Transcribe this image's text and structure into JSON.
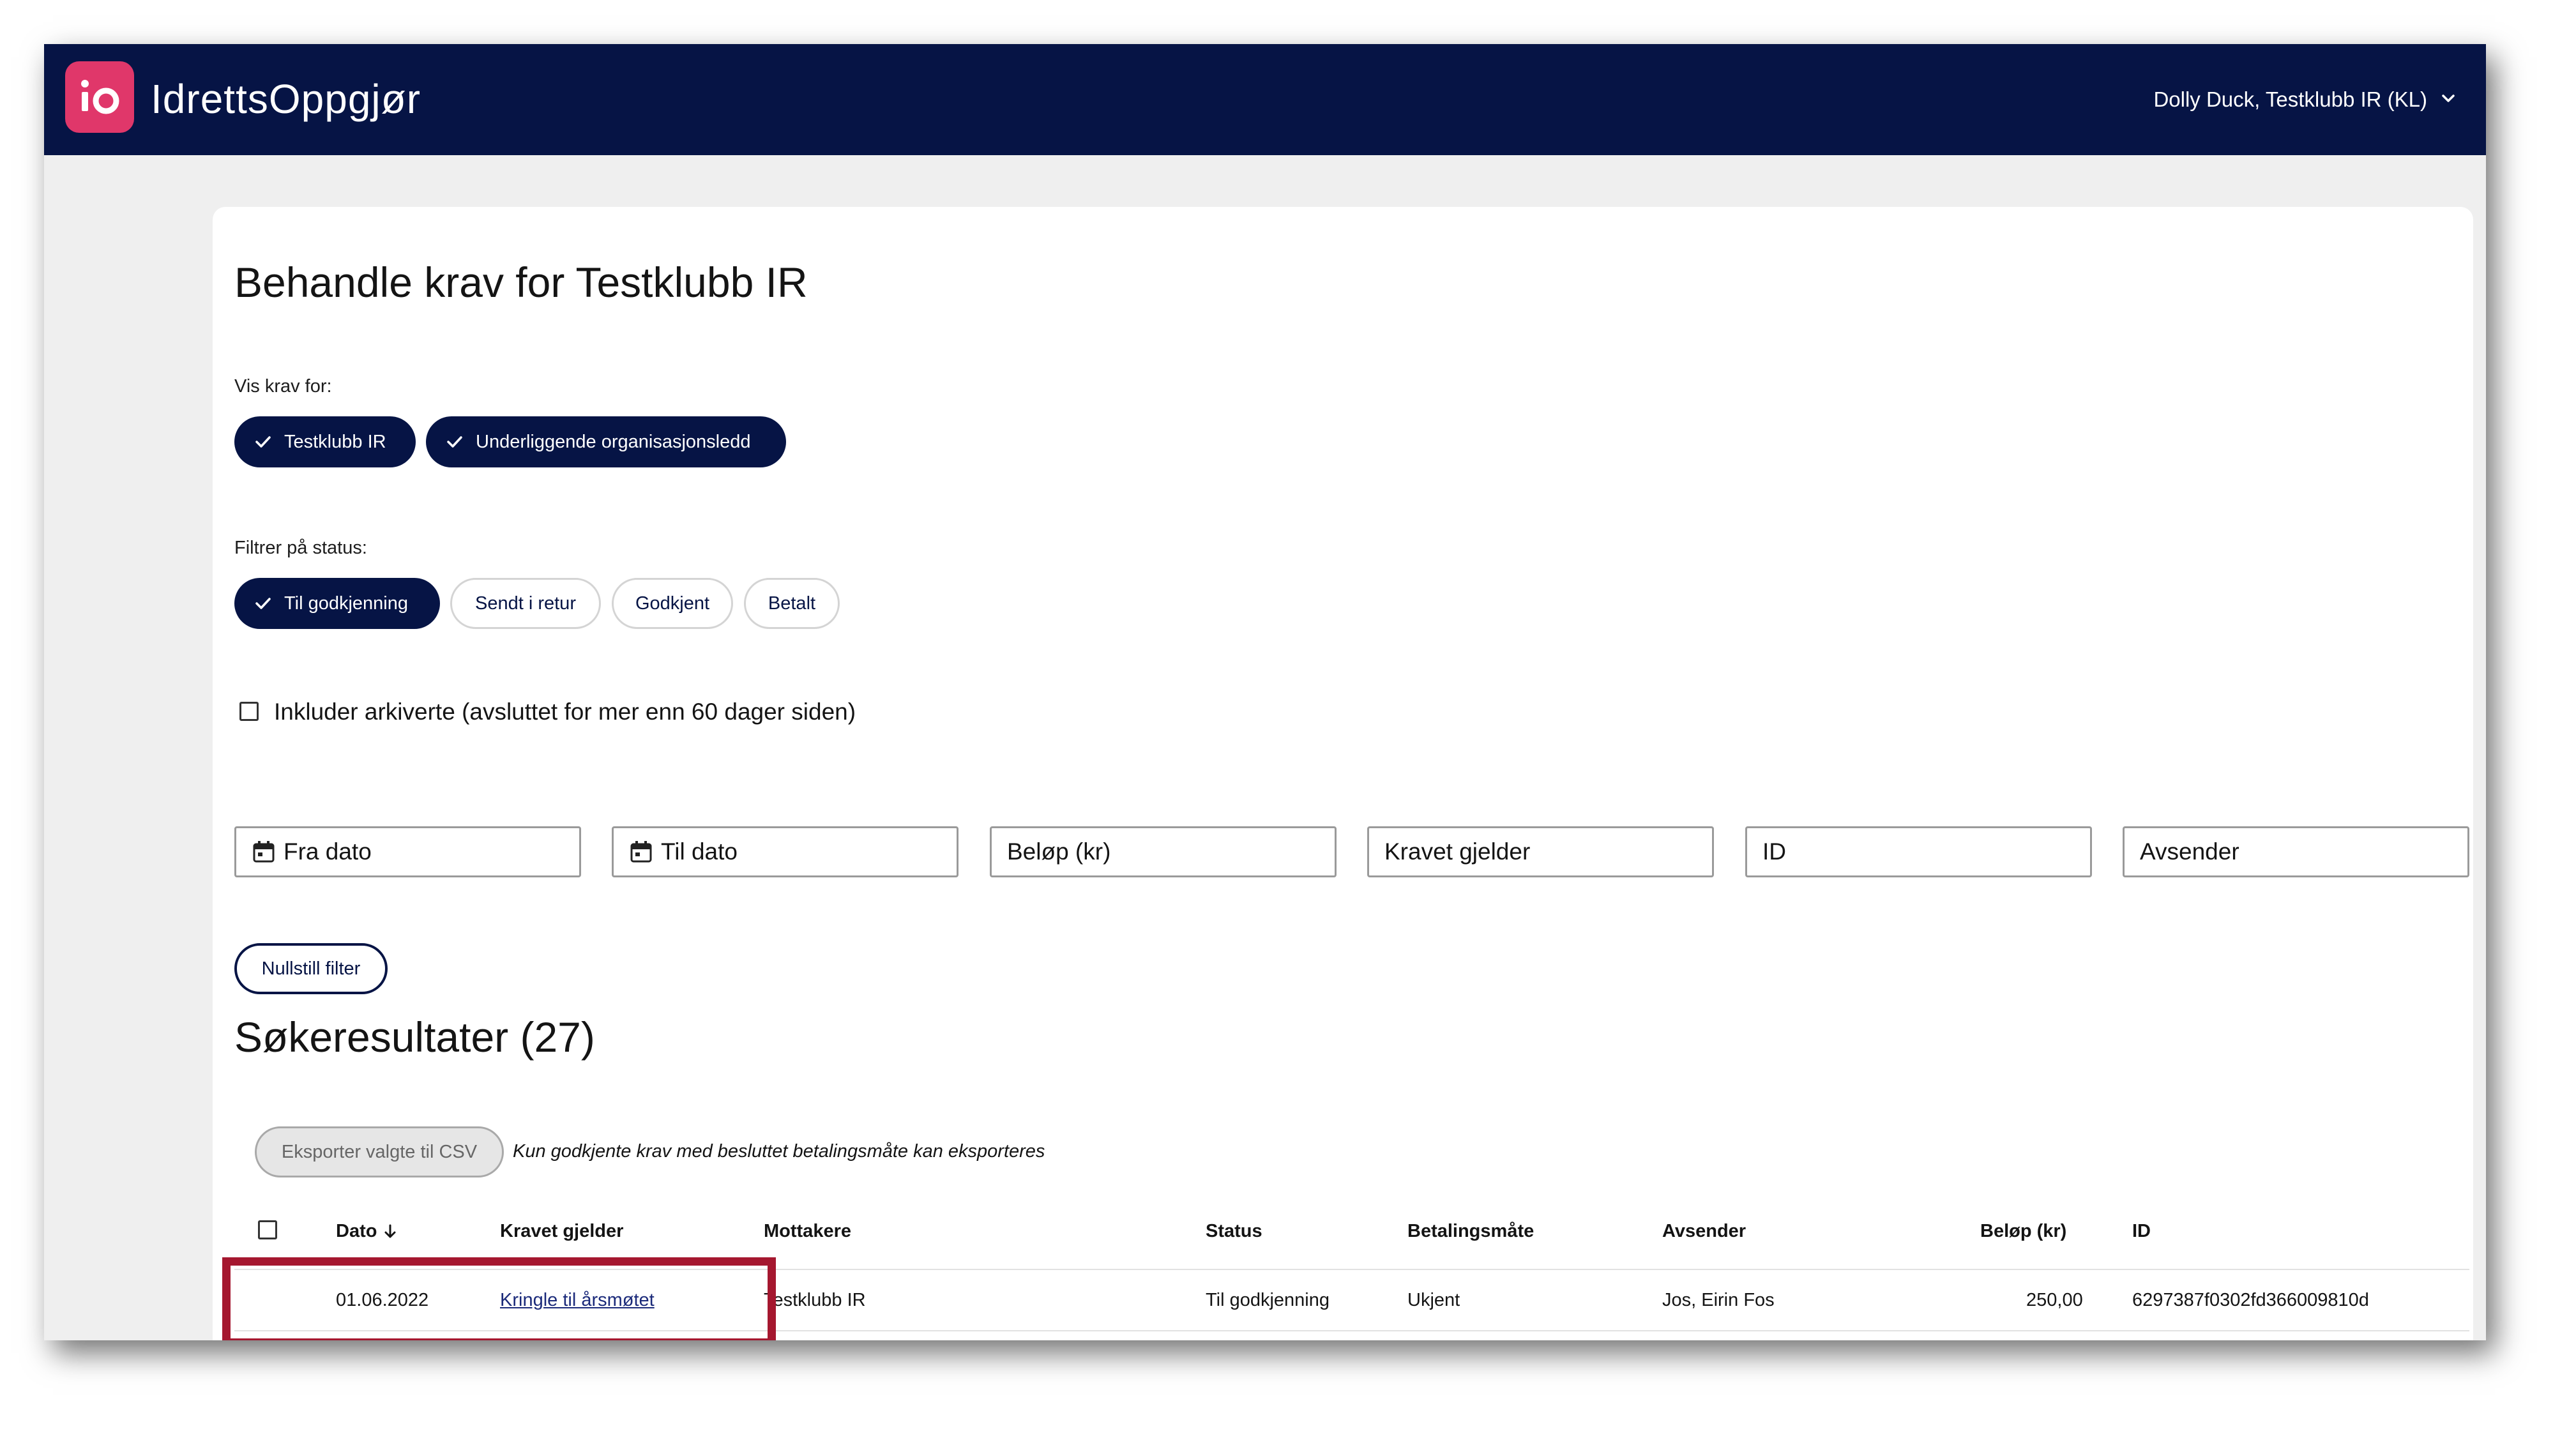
{
  "header": {
    "logo_icon": "io-logo-icon",
    "brand_color": "#e0376a",
    "bar_color": "#061445",
    "app_name": "IdrettsOppgjør",
    "user_label": "Dolly Duck, Testklubb IR (KL)"
  },
  "page": {
    "title": "Behandle krav for Testklubb IR",
    "show_for_label": "Vis krav for:",
    "show_for_chips": [
      {
        "label": "Testklubb IR",
        "selected": true
      },
      {
        "label": "Underliggende organisasjonsledd",
        "selected": true
      }
    ],
    "status_label": "Filtrer på status:",
    "status_chips": [
      {
        "label": "Til godkjenning",
        "selected": true
      },
      {
        "label": "Sendt i retur",
        "selected": false
      },
      {
        "label": "Godkjent",
        "selected": false
      },
      {
        "label": "Betalt",
        "selected": false
      }
    ],
    "include_archived_label": "Inkluder arkiverte (avsluttet for mer enn 60 dager siden)",
    "include_archived_checked": false,
    "filters": {
      "from_date": "Fra dato",
      "to_date": "Til dato",
      "amount": "Beløp (kr)",
      "claim_for": "Kravet gjelder",
      "id": "ID",
      "sender": "Avsender"
    },
    "reset_button": "Nullstill filter"
  },
  "results": {
    "title": "Søkeresultater (27)",
    "export_button": "Eksporter valgte til CSV",
    "export_note": "Kun godkjente krav med besluttet betalingsmåte kan eksporteres",
    "columns": {
      "date": "Dato",
      "claim": "Kravet gjelder",
      "recipients": "Mottakere",
      "status": "Status",
      "payment": "Betalingsmåte",
      "sender": "Avsender",
      "amount": "Beløp (kr)",
      "id": "ID"
    },
    "rows": [
      {
        "date": "01.06.2022",
        "claim": "Kringle til årsmøtet",
        "recipients": "Testklubb IR",
        "status": "Til godkjenning",
        "payment": "Ukjent",
        "sender": "Jos, Eirin Fos",
        "amount": "250,00",
        "id": "6297387f0302fd366009810d"
      }
    ]
  },
  "annotation": {
    "highlight_color": "#a5172f"
  }
}
